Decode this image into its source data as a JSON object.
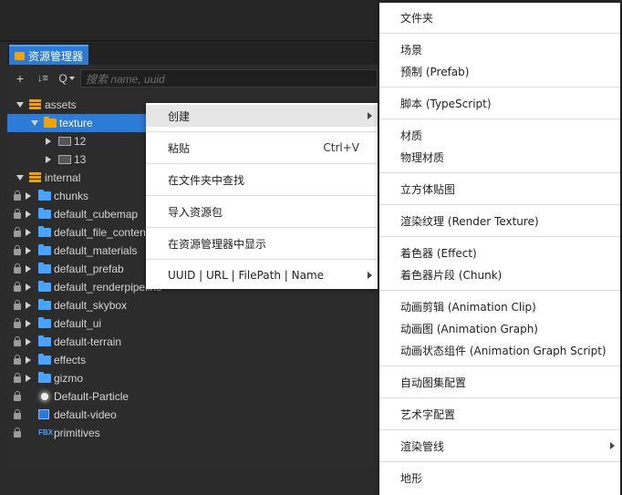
{
  "panel": {
    "tab_title": "资源管理器",
    "search_placeholder": "搜索 name, uuid"
  },
  "toolbar": {
    "add_label": "+",
    "sort_label": "↓≡",
    "search_filter_label": "Q"
  },
  "tree": [
    {
      "label": "assets",
      "icon": "database-icon",
      "level": 0,
      "expanded": true,
      "locked": false
    },
    {
      "label": "texture",
      "icon": "folder-icon",
      "level": 1,
      "expanded": true,
      "locked": false,
      "selected": true
    },
    {
      "label": "12",
      "icon": "image-icon",
      "level": 2,
      "expanded": false,
      "locked": false
    },
    {
      "label": "13",
      "icon": "image-icon",
      "level": 2,
      "expanded": false,
      "locked": false
    },
    {
      "label": "internal",
      "icon": "database-icon",
      "level": 0,
      "expanded": true,
      "locked": false
    },
    {
      "label": "chunks",
      "icon": "folder-icon",
      "level": 1,
      "locked": true
    },
    {
      "label": "default_cubemap",
      "icon": "folder-icon",
      "level": 1,
      "locked": true
    },
    {
      "label": "default_file_content",
      "icon": "folder-icon",
      "level": 1,
      "locked": true
    },
    {
      "label": "default_materials",
      "icon": "folder-icon",
      "level": 1,
      "locked": true
    },
    {
      "label": "default_prefab",
      "icon": "folder-icon",
      "level": 1,
      "locked": true
    },
    {
      "label": "default_renderpipeline",
      "icon": "folder-icon",
      "level": 1,
      "locked": true
    },
    {
      "label": "default_skybox",
      "icon": "folder-icon",
      "level": 1,
      "locked": true
    },
    {
      "label": "default_ui",
      "icon": "folder-icon",
      "level": 1,
      "locked": true
    },
    {
      "label": "default-terrain",
      "icon": "folder-icon",
      "level": 1,
      "locked": true
    },
    {
      "label": "effects",
      "icon": "folder-icon",
      "level": 1,
      "locked": true
    },
    {
      "label": "gizmo",
      "icon": "folder-icon",
      "level": 1,
      "locked": true
    },
    {
      "label": "Default-Particle",
      "icon": "particle-icon",
      "level": 1,
      "locked": true
    },
    {
      "label": "default-video",
      "icon": "video-icon",
      "level": 1,
      "locked": true
    },
    {
      "label": "primitives",
      "icon": "fbx-icon",
      "icon_text": "FBX",
      "level": 1,
      "locked": true
    }
  ],
  "context_menu": {
    "items": [
      {
        "label": "创建",
        "submenu": true,
        "hover": true
      },
      {
        "label": "粘贴",
        "shortcut": "Ctrl+V"
      },
      {
        "label": "在文件夹中查找"
      },
      {
        "label": "导入资源包"
      },
      {
        "label": "在资源管理器中显示"
      },
      {
        "label": "UUID | URL | FilePath | Name",
        "submenu": true
      }
    ]
  },
  "create_submenu": {
    "items": [
      {
        "label": "文件夹"
      },
      {
        "label": "场景"
      },
      {
        "label": "预制 (Prefab)"
      },
      {
        "label": "脚本 (TypeScript)"
      },
      {
        "label": "材质"
      },
      {
        "label": "物理材质"
      },
      {
        "label": "立方体贴图"
      },
      {
        "label": "渲染纹理 (Render Texture)"
      },
      {
        "label": "着色器 (Effect)"
      },
      {
        "label": "着色器片段 (Chunk)"
      },
      {
        "label": "动画剪辑 (Animation Clip)"
      },
      {
        "label": "动画图 (Animation Graph)"
      },
      {
        "label": "动画状态组件 (Animation Graph Script)"
      },
      {
        "label": "自动图集配置"
      },
      {
        "label": "艺术字配置"
      },
      {
        "label": "渲染管线",
        "submenu": true
      },
      {
        "label": "地形"
      }
    ]
  }
}
